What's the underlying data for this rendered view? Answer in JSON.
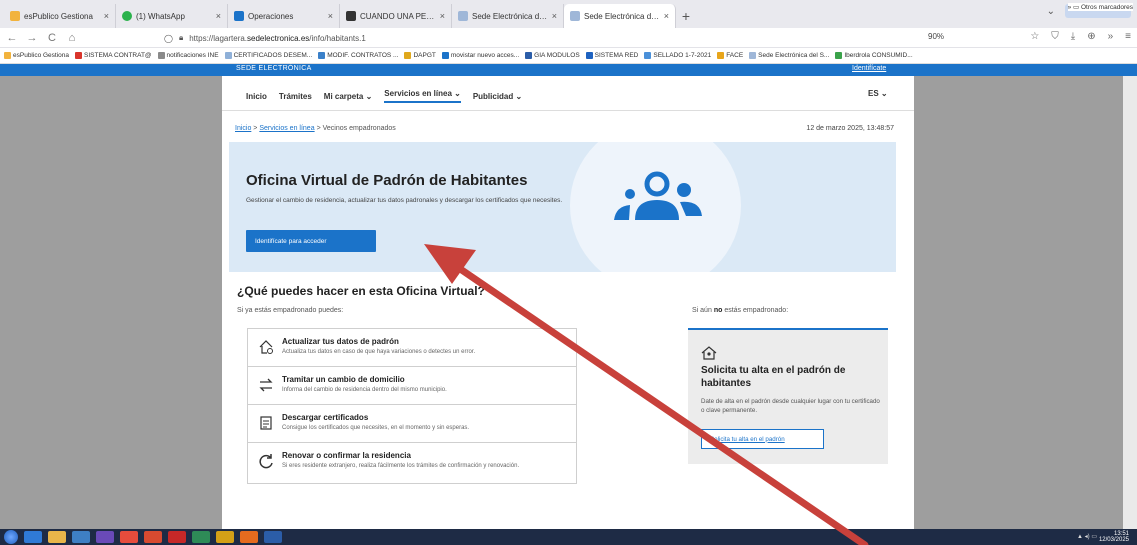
{
  "browser": {
    "tabs": [
      {
        "label": "esPublico Gestiona",
        "color": "#f2b33d"
      },
      {
        "label": "(1) WhatsApp",
        "color": "#2bb24c"
      },
      {
        "label": "Operaciones",
        "color": "#1b73c9"
      },
      {
        "label": "CUANDO UNA PERSONA SE C",
        "color": "#333333"
      },
      {
        "label": "Sede Electrónica de Lagartera",
        "color": "#9fb7d8"
      },
      {
        "label": "Sede Electrónica de Lagartera",
        "color": "#9fb7d8",
        "active": true
      }
    ],
    "close_glyph": "×",
    "new_tab_glyph": "+",
    "url_prefix": "https://lagartera.",
    "url_host": "sedelectronica.es",
    "url_suffix": "/info/habitants.1",
    "zoom": "90%",
    "bookmarks": [
      {
        "label": "esPublico Gestiona",
        "color": "#f2b33d"
      },
      {
        "label": "SISTEMA CONTRAT@",
        "color": "#d9342b"
      },
      {
        "label": "notificaciones INE",
        "color": "#8a8a8a"
      },
      {
        "label": "CERTIFICADOS DESEM...",
        "color": "#8fb0d8"
      },
      {
        "label": "MODIF. CONTRATOS ...",
        "color": "#3a80c9"
      },
      {
        "label": "DAPGT",
        "color": "#e0a81c"
      },
      {
        "label": "movistar nuevo acces...",
        "color": "#1b73c9"
      },
      {
        "label": "GIA MODULOS",
        "color": "#2b5da8"
      },
      {
        "label": "SISTEMA RED",
        "color": "#1e62c0"
      },
      {
        "label": "SELLADO 1-7-2021",
        "color": "#4a90d9"
      },
      {
        "label": "FACE",
        "color": "#e8a51a"
      },
      {
        "label": "Sede Electrónica del S...",
        "color": "#9fb7d8"
      },
      {
        "label": "Iberdrola CONSUMID...",
        "color": "#3aa24a"
      }
    ],
    "other_bookmarks": "Otros marcadores"
  },
  "site": {
    "brand": "SEDE ELECTRÓNICA",
    "login": "Identifícate",
    "nav": [
      "Inicio",
      "Trámites",
      "Mi carpeta ⌄",
      "Servicios en línea ⌄",
      "Publicidad ⌄"
    ],
    "lang": "ES ⌄",
    "breadcrumb": {
      "home": "Inicio",
      "sep": ">",
      "section": "Servicios en línea",
      "current": "Vecinos empadronados"
    },
    "date": "12 de marzo 2025, 13:48:57"
  },
  "hero": {
    "title": "Oficina Virtual de Padrón de Habitantes",
    "description": "Gestionar el cambio de residencia, actualizar tus datos padronales y descargar los certificados que necesites.",
    "cta": "Identifícate para acceder"
  },
  "section": {
    "title": "¿Qué puedes hacer en esta Oficina Virtual?",
    "left_sub": "Si ya estás empadronado puedes:",
    "right_sub_pre": "Si aún",
    "right_sub_bold": "no",
    "right_sub_post": "estás empadronado:",
    "cards": [
      {
        "title": "Actualizar tus datos de padrón",
        "desc": "Actualiza tus datos en caso de que haya variaciones o detectes un error.",
        "icon": "house-refresh-icon"
      },
      {
        "title": "Tramitar un cambio de domicilio",
        "desc": "Informa del cambio de residencia dentro del mismo municipio.",
        "icon": "swap-arrows-icon"
      },
      {
        "title": "Descargar certificados",
        "desc": "Consigue los certificados que necesites, en el momento y sin esperas.",
        "icon": "document-icon"
      },
      {
        "title": "Renovar o confirmar la residencia",
        "desc": "Si eres residente extranjero, realiza fácilmente los trámites de confirmación y renovación.",
        "icon": "refresh-icon"
      }
    ],
    "signup": {
      "title": "Solicita tu alta en el padrón de habitantes",
      "desc": "Date de alta en el padrón desde cualquier lugar con tu certificado o clave permanente.",
      "button": "Solicita tu alta en el padrón"
    }
  },
  "taskbar": {
    "time": "13:51",
    "date": "12/03/2025"
  },
  "colors": {
    "accent": "#1b73c9",
    "arrow": "#c8413b"
  }
}
